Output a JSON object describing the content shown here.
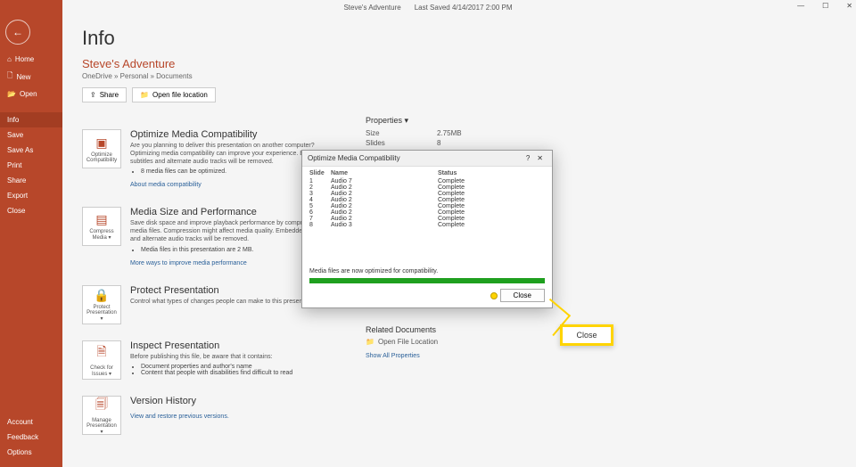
{
  "titlebar": {
    "doc": "Steve's Adventure",
    "saved": "Last Saved 4/14/2017 2:00 PM"
  },
  "wincontrols": {
    "min": "—",
    "max": "☐",
    "close": "✕"
  },
  "sidebar": {
    "back": "←",
    "items": [
      {
        "icon": "⌂",
        "label": "Home"
      },
      {
        "icon": "🗋",
        "label": "New"
      },
      {
        "icon": "📂",
        "label": "Open"
      }
    ],
    "items2": [
      {
        "label": "Info"
      },
      {
        "label": "Save"
      },
      {
        "label": "Save As"
      },
      {
        "label": "Print"
      },
      {
        "label": "Share"
      },
      {
        "label": "Export"
      },
      {
        "label": "Close"
      }
    ],
    "bottom": [
      {
        "label": "Account"
      },
      {
        "label": "Feedback"
      },
      {
        "label": "Options"
      }
    ]
  },
  "page": {
    "title": "Info",
    "docname": "Steve's Adventure",
    "path": "OneDrive » Personal » Documents",
    "share": "Share",
    "openloc": "Open file location"
  },
  "sections": {
    "optimize": {
      "card": "Optimize Compatibility",
      "title": "Optimize Media Compatibility",
      "desc": "Are you planning to deliver this presentation on another computer? Optimizing media compatibility can improve your experience. Embedded subtitles and alternate audio tracks will be removed.",
      "bullet": "8 media files can be optimized.",
      "link": "About media compatibility"
    },
    "media": {
      "card": "Compress Media ▾",
      "title": "Media Size and Performance",
      "desc": "Save disk space and improve playback performance by compressing your media files. Compression might affect media quality. Embedded subtitles and alternate audio tracks will be removed.",
      "bullet": "Media files in this presentation are 2 MB.",
      "link": "More ways to improve media performance"
    },
    "protect": {
      "card": "Protect Presentation ▾",
      "title": "Protect Presentation",
      "desc": "Control what types of changes people can make to this presentation."
    },
    "inspect": {
      "card": "Check for Issues ▾",
      "title": "Inspect Presentation",
      "desc": "Before publishing this file, be aware that it contains:",
      "b1": "Document properties and author's name",
      "b2": "Content that people with disabilities find difficult to read"
    },
    "history": {
      "card": "Manage Presentation ▾",
      "title": "Version History",
      "link": "View and restore previous versions."
    }
  },
  "props": {
    "heading": "Properties ▾",
    "rows": [
      {
        "k": "Size",
        "v": "2.75MB"
      },
      {
        "k": "Slides",
        "v": "8"
      }
    ]
  },
  "related": {
    "heading": "Related Documents",
    "open": "Open File Location",
    "showall": "Show All Properties"
  },
  "dialog": {
    "title": "Optimize Media Compatibility",
    "help": "?",
    "close_icon": "✕",
    "cols": {
      "c1": "Slide",
      "c2": "Name",
      "c3": "Status"
    },
    "rows": [
      {
        "s": "1",
        "n": "Audio 7",
        "st": "Complete"
      },
      {
        "s": "2",
        "n": "Audio 2",
        "st": "Complete"
      },
      {
        "s": "3",
        "n": "Audio 2",
        "st": "Complete"
      },
      {
        "s": "4",
        "n": "Audio 2",
        "st": "Complete"
      },
      {
        "s": "5",
        "n": "Audio 2",
        "st": "Complete"
      },
      {
        "s": "6",
        "n": "Audio 2",
        "st": "Complete"
      },
      {
        "s": "7",
        "n": "Audio 2",
        "st": "Complete"
      },
      {
        "s": "8",
        "n": "Audio 3",
        "st": "Complete"
      }
    ],
    "status": "Media files are now optimized for compatibility.",
    "close": "Close"
  },
  "callout": {
    "label": "Close"
  }
}
